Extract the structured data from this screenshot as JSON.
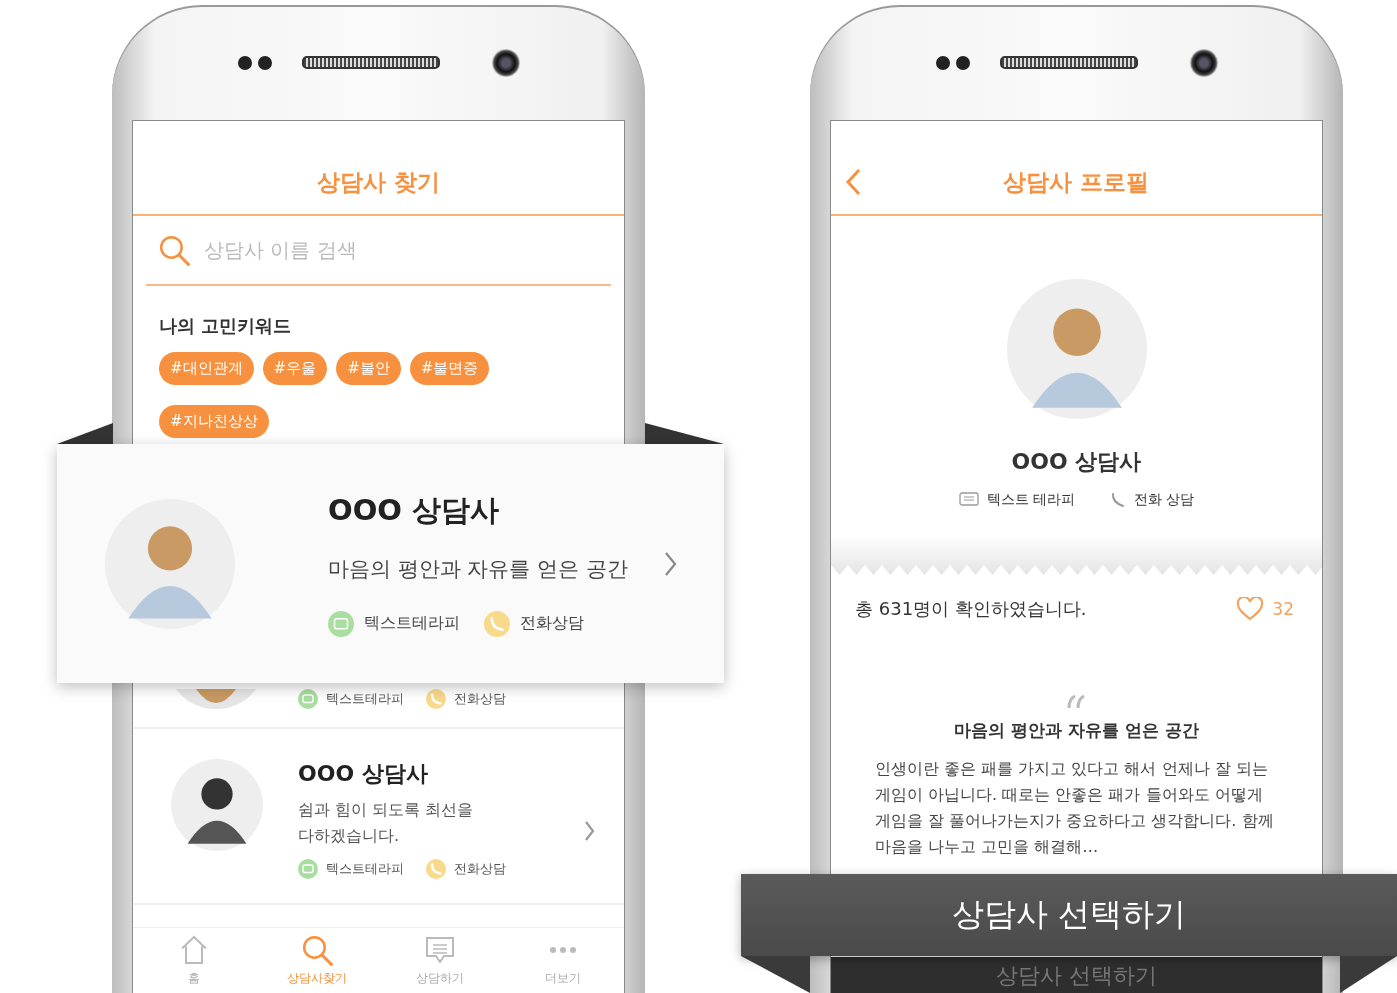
{
  "finder": {
    "title": "상담사 찾기",
    "search": {
      "placeholder": "상담사 이름 검색"
    },
    "keywords_title": "나의 고민키워드",
    "keywords": [
      "#대인관계",
      "#우울",
      "#불안",
      "#불면증",
      "#지나친상상"
    ],
    "counselors": [
      {
        "tags": [
          {
            "kind": "text",
            "label": "텍스트테라피"
          },
          {
            "kind": "phone",
            "label": "전화상담"
          }
        ]
      },
      {
        "name": "OOO 상담사",
        "description": "쉼과 힘이 되도록 최선을 다하겠습니다.",
        "tags": [
          {
            "kind": "text",
            "label": "텍스트테라피"
          },
          {
            "kind": "phone",
            "label": "전화상담"
          }
        ]
      }
    ],
    "nav": [
      {
        "kind": "home",
        "label": "홈",
        "selected": false
      },
      {
        "kind": "search",
        "label": "상담사찾기",
        "selected": true
      },
      {
        "kind": "chat",
        "label": "상담하기",
        "selected": false
      },
      {
        "kind": "more",
        "label": "더보기",
        "selected": false
      }
    ]
  },
  "profile": {
    "title": "상담사 프로필",
    "name": "OOO 상담사",
    "services": [
      {
        "kind": "text",
        "label": "텍스트 테라피"
      },
      {
        "kind": "phone",
        "label": "전화 상담"
      }
    ],
    "views": "총 631명이 확인하였습니다.",
    "likes": "32",
    "quote_title": "마음의 평안과 자유를 얻은 공간",
    "intro": "인생이란 좋은 패를 가지고 있다고 해서 언제나 잘 되는 게임이 아닙니다. 때로는 안좋은 패가 들어와도 어떻게 게임을 잘 풀어나가는지가 중요하다고 생각합니다. 함께 마음을 나누고 고민을 해결해…",
    "button": "상담사 선택하기"
  },
  "callout_card": {
    "name": "OOO 상담사",
    "description": "마음의 평안과 자유를 얻은 공간",
    "tags": [
      {
        "kind": "text",
        "label": "텍스트테라피"
      },
      {
        "kind": "phone",
        "label": "전화상담"
      }
    ]
  },
  "callout_button": {
    "label": "상담사 선택하기"
  }
}
